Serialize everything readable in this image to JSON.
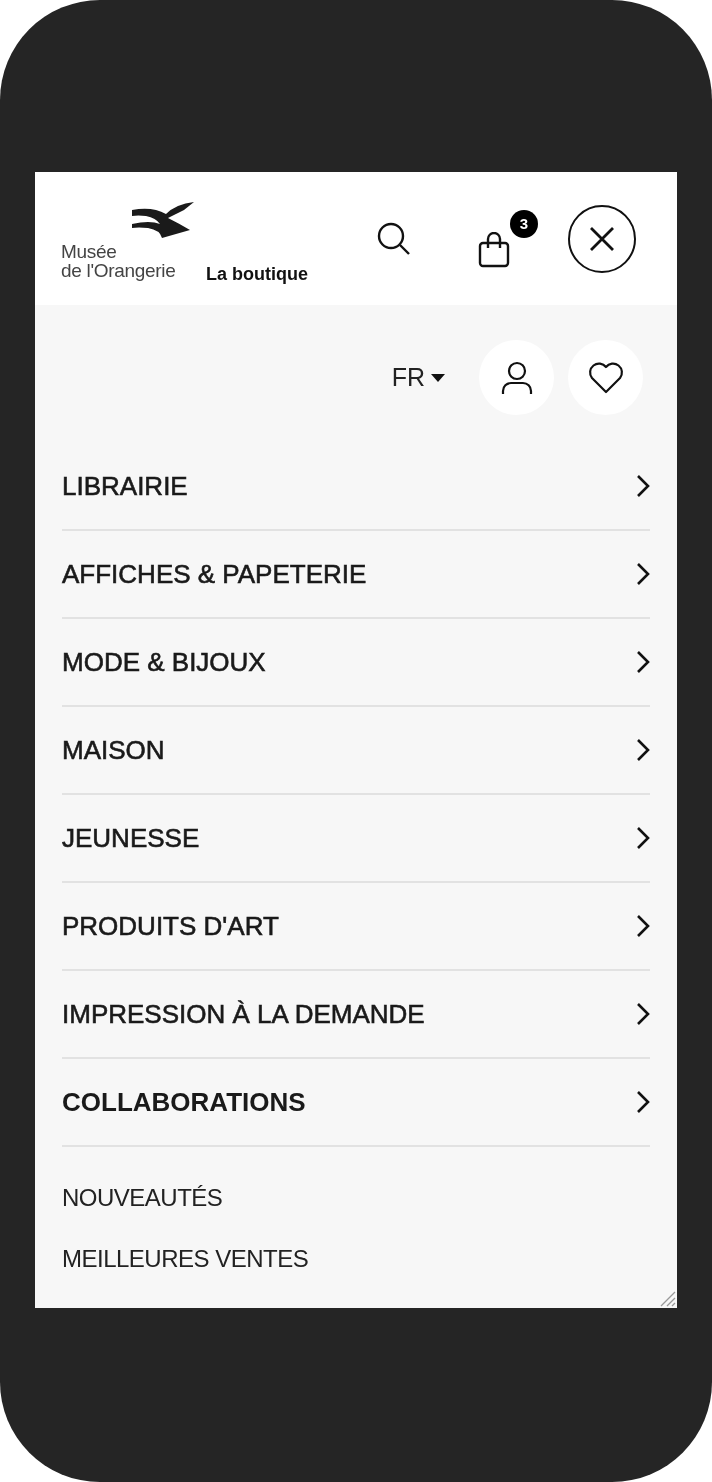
{
  "header": {
    "logo_line_1": "Musée",
    "logo_line_2": "de l'Orangerie",
    "shop_name": "La boutique",
    "cart_count": "3"
  },
  "toolbar": {
    "language": "FR"
  },
  "menu": [
    {
      "label": "LIBRAIRIE",
      "emphasized": false
    },
    {
      "label": "AFFICHES & PAPETERIE",
      "emphasized": false
    },
    {
      "label": "MODE & BIJOUX",
      "emphasized": false
    },
    {
      "label": "MAISON",
      "emphasized": false
    },
    {
      "label": "JEUNESSE",
      "emphasized": false
    },
    {
      "label": "PRODUITS D'ART",
      "emphasized": false
    },
    {
      "label": "IMPRESSION À LA DEMANDE",
      "emphasized": false
    },
    {
      "label": "COLLABORATIONS",
      "emphasized": true
    }
  ],
  "secondary_links": [
    "NOUVEAUTÉS",
    "MEILLEURES VENTES"
  ]
}
